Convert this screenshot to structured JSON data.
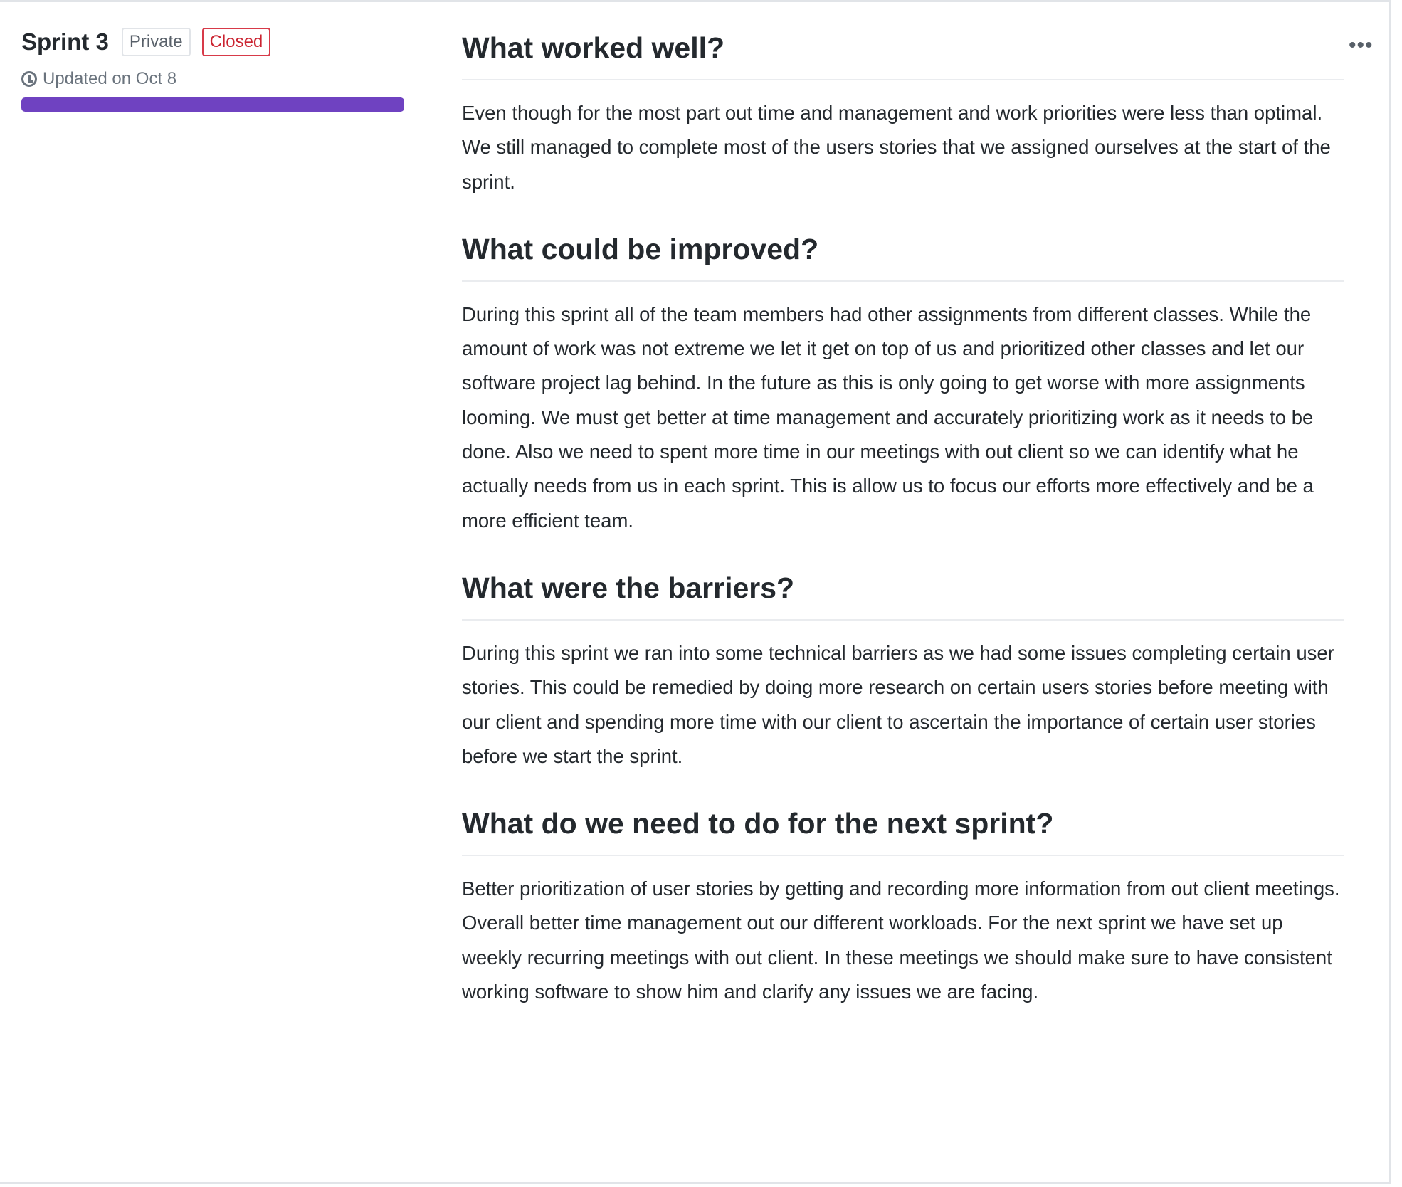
{
  "sidebar": {
    "title": "Sprint 3",
    "visibility_badge": "Private",
    "status_badge": "Closed",
    "updated": "Updated on Oct 8",
    "progress_percent": 100,
    "progress_color": "#6f42c1"
  },
  "menu": {
    "icon": "kebab-horizontal-icon",
    "label": "•••"
  },
  "sections": [
    {
      "heading": "What worked well?",
      "body": "Even though for the most part out time and management and work priorities were less than optimal. We still managed to complete most of the users stories that we assigned ourselves at the start of the sprint."
    },
    {
      "heading": "What could be improved?",
      "body": "During this sprint all of the team members had other assignments from different classes. While the amount of work was not extreme we let it get on top of us and prioritized other classes and let our software project lag behind. In the future as this is only going to get worse with more assignments looming. We must get better at time management and accurately prioritizing work as it needs to be done. Also we need to spent more time in our meetings with out client so we can identify what he actually needs from us in each sprint. This is allow us to focus our efforts more effectively and be a more efficient team."
    },
    {
      "heading": "What were the barriers?",
      "body": "During this sprint we ran into some technical barriers as we had some issues completing certain user stories. This could be remedied by doing more research on certain users stories before meeting with our client and spending more time with our client to ascertain the importance of certain user stories before we start the sprint."
    },
    {
      "heading": "What do we need to do for the next sprint?",
      "body": "Better prioritization of user stories by getting and recording more information from out client meetings. Overall better time management out our different workloads. For the next sprint we have set up weekly recurring meetings with out client. In these meetings we should make sure to have consistent working software to show him and clarify any issues we are facing."
    }
  ]
}
